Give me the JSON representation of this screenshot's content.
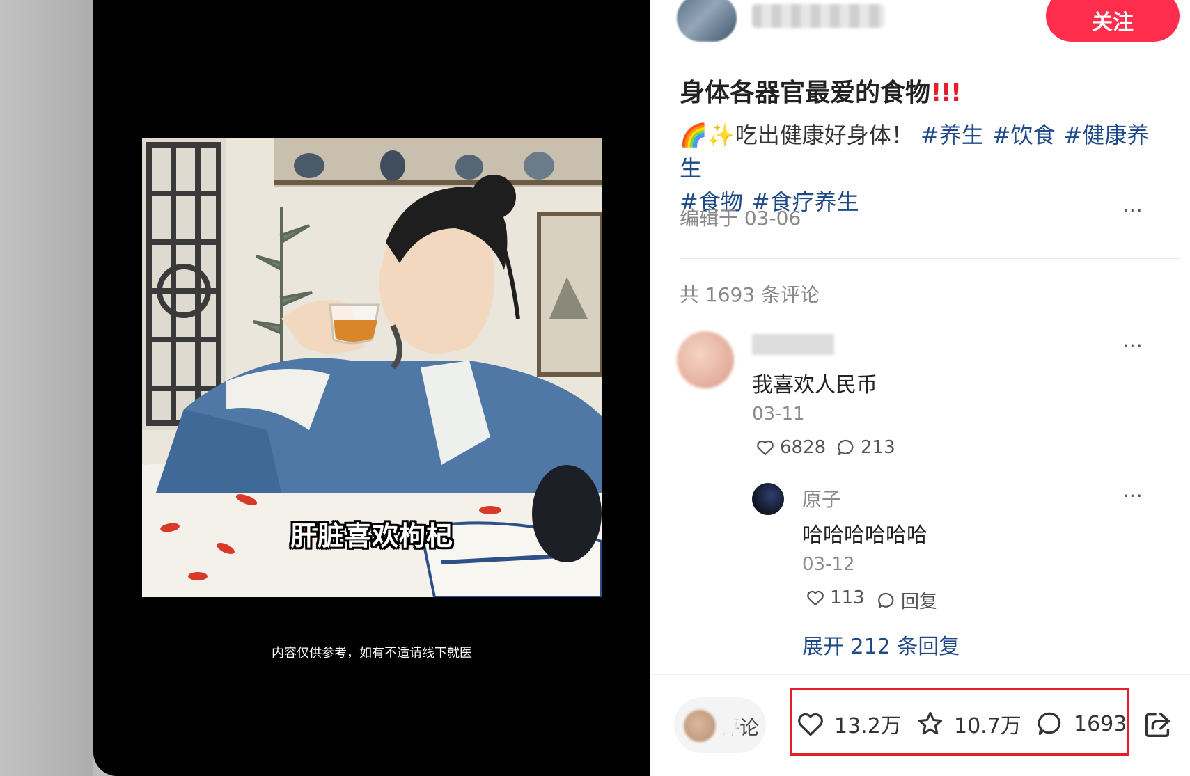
{
  "media": {
    "caption": "肝脏喜欢枸杞",
    "disclaimer": "内容仅供参考，如有不适请线下就医"
  },
  "header": {
    "follow_label": "关注"
  },
  "post": {
    "title": "身体各器官最爱的食物",
    "title_emphasis": "!!!",
    "desc_emoji": "🌈✨",
    "desc_text": "吃出健康好身体！",
    "tags": [
      "#养生",
      "#饮食",
      "#健康养生",
      "#食物",
      "#食疗养生"
    ],
    "edited": "编辑于 03-06"
  },
  "comments": {
    "count_text": "共 1693 条评论",
    "first": {
      "text": "我喜欢人民币",
      "date": "03-11",
      "likes": "6828",
      "replies": "213",
      "reply": {
        "author": "原子",
        "text": "哈哈哈哈哈哈",
        "date": "03-12",
        "likes": "113",
        "reply_label": "回复"
      },
      "expand_label": "展开 212 条回复"
    }
  },
  "more_icon": "more-icon",
  "bottom_bar": {
    "comment_placeholder": "评论",
    "likes": "13.2万",
    "favorites": "10.7万",
    "comments": "1693",
    "highlight_color": "#e21f2a"
  },
  "colors": {
    "accent": "#ff2e4d",
    "link": "#1f4a8a"
  }
}
